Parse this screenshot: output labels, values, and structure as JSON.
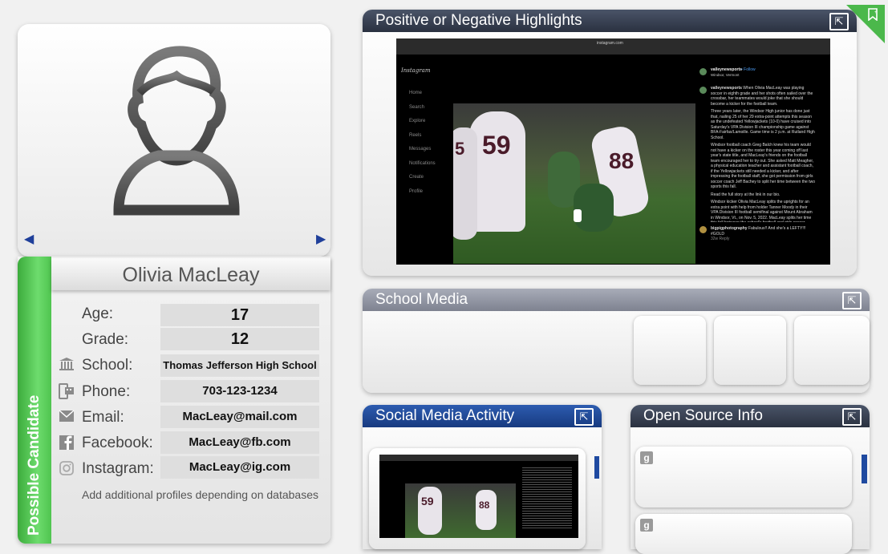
{
  "profile": {
    "name": "Olivia MacLeay",
    "side_label": "Possible Candidate",
    "fields": {
      "age": {
        "label": "Age:",
        "value": "17"
      },
      "grade": {
        "label": "Grade:",
        "value": "12"
      },
      "school": {
        "label": "School:",
        "value": "Thomas Jefferson High School"
      },
      "phone": {
        "label": "Phone:",
        "value": "703-123-1234"
      },
      "email": {
        "label": "Email:",
        "value": "MacLeay@mail.com"
      },
      "facebook": {
        "label": "Facebook:",
        "value": "MacLeay@fb.com"
      },
      "instagram": {
        "label": "Instagram:",
        "value": "MacLeay@ig.com"
      }
    },
    "note": "Add additional profiles depending on databases"
  },
  "panels": {
    "highlights": {
      "title": "Positive or Negative Highlights"
    },
    "school_media": {
      "title": "School Media"
    },
    "social_media": {
      "title": "Social Media Activity"
    },
    "open_source": {
      "title": "Open Source Info"
    }
  },
  "instagram_post": {
    "logo": "Instagram",
    "url": "instagram.com",
    "nav": [
      "Home",
      "Search",
      "Explore",
      "Reels",
      "Messages",
      "Notifications",
      "Create",
      "Profile"
    ],
    "account": "valleynewsports",
    "follow": "• Follow",
    "location": "Windsor, Vermont",
    "caption_author": "valleynewsports",
    "caption_p1": "When Olivia MacLeay was playing soccer in eighth grade and her shots often sailed over the crossbar, her teammates would joke that she should become a kicker for the football team.",
    "caption_p2": "Three years later, the Windsor High junior has done just that, nailing 25 of her 29 extra-point attempts this season as the undefeated Yellowjackets (10-0) have cruised into Saturday's VPA Division III championship game against BFA-Fairfax/Lamoille. Game time is 2 p.m. at Rutland High School.",
    "caption_p3": "Windsor football coach Greg Balch knew his team would not have a kicker on the roster this year coming off last year's state title, and MacLeay's friends on the football team encouraged her to try out. She asked Matt Meagher, a physical education teacher and assistant football coach, if the Yellowjackets still needed a kicker, and after impressing the football staff, she got permission from girls soccer coach Jeff Bachey to split her time between the two sports this fall.",
    "caption_p4": "Read the full story at the link in our bio.",
    "caption_p5": "Windsor kicker Olivia MacLeay splits the uprights for an extra point with help from holder Tanner Moody in their VPA Division III football semifinal against Mount Abraham in Windsor, Vt., on Nov. 5, 2022. MacLeay splits her time this fall between the school's football and girls soccer teams. (Valley News - Geoff Hansen @geoff_hansen)",
    "caption_time": "32w",
    "comment_author": "bigpigphotography",
    "comment_text": "Fabulous!! And she's a LEFTY!!! #GOLD",
    "comment_meta": "32w   Reply",
    "jersey_1": "59",
    "jersey_2": "88",
    "jersey_3": "5"
  },
  "colors": {
    "accent_green": "#4fc44f",
    "header_dark": "#2a3140",
    "header_blue": "#173a80",
    "header_gray": "#7e8290",
    "arrow_blue": "#1f3f9a"
  }
}
